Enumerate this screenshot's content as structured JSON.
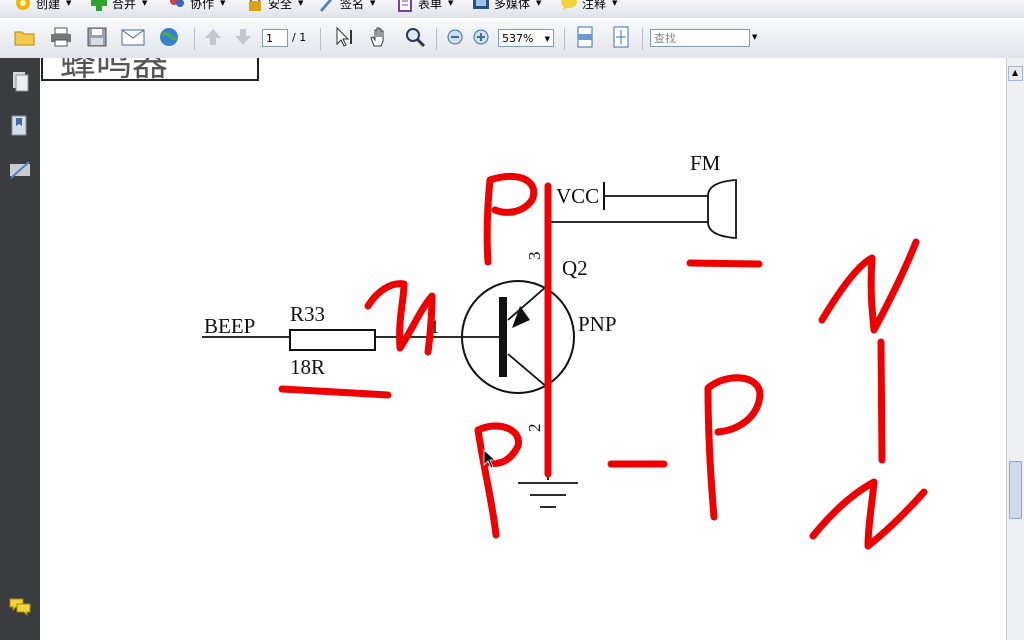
{
  "menubar": {
    "items": [
      {
        "label": "创建",
        "icon": "gear-create-icon"
      },
      {
        "label": "合并",
        "icon": "green-plus-icon"
      },
      {
        "label": "协作",
        "icon": "people-icon"
      },
      {
        "label": "安全",
        "icon": "lock-icon"
      },
      {
        "label": "签名",
        "icon": "pen-icon"
      },
      {
        "label": "表单",
        "icon": "form-icon"
      },
      {
        "label": "多媒体",
        "icon": "film-icon"
      },
      {
        "label": "注释",
        "icon": "comment-bubble-icon"
      }
    ]
  },
  "toolbar": {
    "page_current": "1",
    "page_total": "/ 1",
    "zoom": "537%",
    "search_placeholder": "查找"
  },
  "document": {
    "heading_fragment": "蜂鸣器",
    "labels": {
      "beep": "BEEP",
      "r33": "R33",
      "r_value": "18R",
      "pin1": "1",
      "pin2": "2",
      "pin3": "3",
      "q2": "Q2",
      "pnp": "PNP",
      "vcc": "VCC",
      "fm": "FM"
    }
  },
  "colors": {
    "annotation_red": "#ee0000",
    "left_panel": "#3a3c40"
  }
}
